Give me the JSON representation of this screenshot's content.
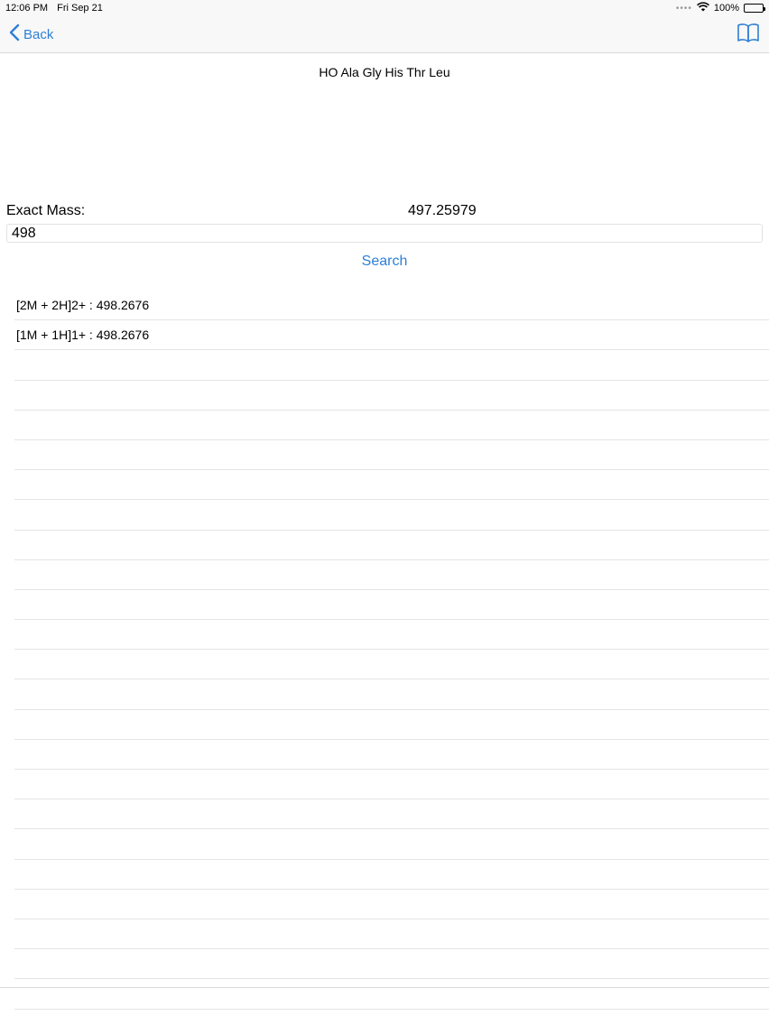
{
  "status": {
    "time": "12:06 PM",
    "date": "Fri Sep 21",
    "battery": "100%"
  },
  "nav": {
    "back_label": "Back",
    "book_icon": "book-icon"
  },
  "sequence_title": "HO Ala Gly His Thr Leu",
  "exact_mass": {
    "label": "Exact Mass:",
    "value": "497.25979"
  },
  "search": {
    "value": "498",
    "button_label": "Search"
  },
  "results": [
    "[2M + 2H]2+ : 498.2676",
    "[1M + 1H]1+ : 498.2676",
    "",
    "",
    "",
    "",
    "",
    "",
    "",
    "",
    "",
    "",
    "",
    "",
    "",
    "",
    "",
    "",
    "",
    "",
    "",
    "",
    "",
    ""
  ],
  "colors": {
    "accent": "#2f7fd6",
    "separator": "#e4e4e4"
  }
}
